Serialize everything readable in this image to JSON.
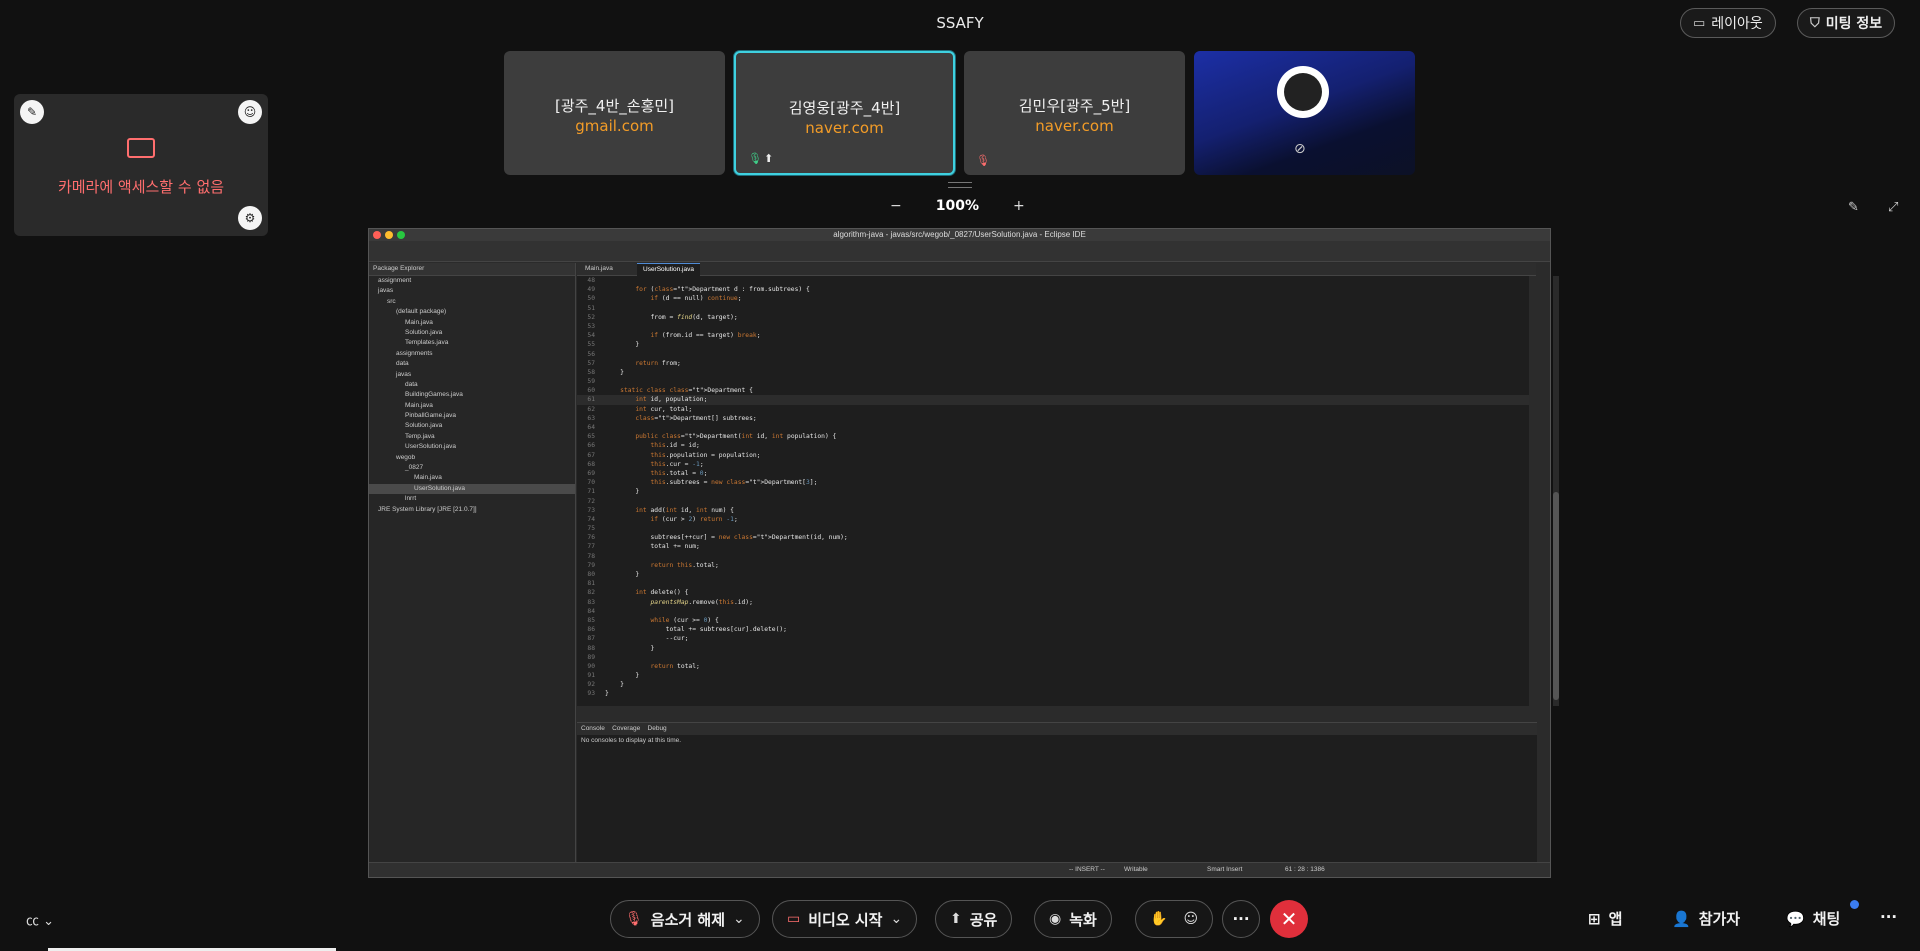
{
  "meeting": {
    "title": "SSAFY"
  },
  "top_buttons": {
    "layout": "레이아웃",
    "meeting_info": "미팅 정보"
  },
  "tiles": [
    {
      "name": "[광주_4반_손홍민]",
      "domain": "gmail.com"
    },
    {
      "name": "김영웅[광주_4반]",
      "domain": "naver.com"
    },
    {
      "name": "김민우[광주_5반]",
      "domain": "naver.com"
    }
  ],
  "self_view": {
    "message": "카메라에 액세스할 수 없음"
  },
  "zoom": {
    "minus": "−",
    "level": "100%",
    "plus": "+"
  },
  "ide": {
    "title": "algorithm-java - javas/src/wegob/_0827/UserSolution.java - Eclipse IDE",
    "package_explorer_tab": "Package Explorer",
    "tree": [
      "assignment",
      "javas",
      "src",
      "(default package)",
      "Main.java",
      "Solution.java",
      "Templates.java",
      "assignments",
      "data",
      "javas",
      "data",
      "BuildingGames.java",
      "Main.java",
      "PinballGame.java",
      "Solution.java",
      "Temp.java",
      "UserSolution.java",
      "wegob",
      "_0827",
      "Main.java",
      "UserSolution.java",
      "lnrrt",
      "JRE System Library [JRE [21.0.7]]"
    ],
    "editor_tabs": [
      "Main.java",
      "UserSolution.java"
    ],
    "code_lines": [
      {
        "n": "48",
        "text": ""
      },
      {
        "n": "49",
        "text": "        for (Department d : from.subtrees) {"
      },
      {
        "n": "50",
        "text": "            if (d == null) continue;"
      },
      {
        "n": "51",
        "text": ""
      },
      {
        "n": "52",
        "text": "            from = find(d, target);"
      },
      {
        "n": "53",
        "text": ""
      },
      {
        "n": "54",
        "text": "            if (from.id == target) break;"
      },
      {
        "n": "55",
        "text": "        }"
      },
      {
        "n": "56",
        "text": ""
      },
      {
        "n": "57",
        "text": "        return from;"
      },
      {
        "n": "58",
        "text": "    }"
      },
      {
        "n": "59",
        "text": ""
      },
      {
        "n": "60",
        "text": "    static class Department {"
      },
      {
        "n": "61",
        "text": "        int id, population;"
      },
      {
        "n": "62",
        "text": "        int cur, total;"
      },
      {
        "n": "63",
        "text": "        Department[] subtrees;"
      },
      {
        "n": "64",
        "text": ""
      },
      {
        "n": "65",
        "text": "        public Department(int id, int population) {"
      },
      {
        "n": "66",
        "text": "            this.id = id;"
      },
      {
        "n": "67",
        "text": "            this.population = population;"
      },
      {
        "n": "68",
        "text": "            this.cur = -1;"
      },
      {
        "n": "69",
        "text": "            this.total = 0;"
      },
      {
        "n": "70",
        "text": "            this.subtrees = new Department[3];"
      },
      {
        "n": "71",
        "text": "        }"
      },
      {
        "n": "72",
        "text": ""
      },
      {
        "n": "73",
        "text": "        int add(int id, int num) {"
      },
      {
        "n": "74",
        "text": "            if (cur > 2) return -1;"
      },
      {
        "n": "75",
        "text": ""
      },
      {
        "n": "76",
        "text": "            subtrees[++cur] = new Department(id, num);"
      },
      {
        "n": "77",
        "text": "            total += num;"
      },
      {
        "n": "78",
        "text": ""
      },
      {
        "n": "79",
        "text": "            return this.total;"
      },
      {
        "n": "80",
        "text": "        }"
      },
      {
        "n": "81",
        "text": ""
      },
      {
        "n": "82",
        "text": "        int delete() {"
      },
      {
        "n": "83",
        "text": "            parentsMap.remove(this.id);"
      },
      {
        "n": "84",
        "text": ""
      },
      {
        "n": "85",
        "text": "            while (cur >= 0) {"
      },
      {
        "n": "86",
        "text": "                total += subtrees[cur].delete();"
      },
      {
        "n": "87",
        "text": "                --cur;"
      },
      {
        "n": "88",
        "text": "            }"
      },
      {
        "n": "89",
        "text": ""
      },
      {
        "n": "90",
        "text": "            return total;"
      },
      {
        "n": "91",
        "text": "        }"
      },
      {
        "n": "92",
        "text": "    }"
      },
      {
        "n": "93",
        "text": "}"
      }
    ],
    "console_tabs": [
      "Console",
      "Coverage",
      "Debug"
    ],
    "console_message": "No consoles to display at this time.",
    "status": {
      "mode": "-- INSERT --",
      "writable": "Writable",
      "insert": "Smart Insert",
      "position": "61 : 28 : 1386"
    }
  },
  "bottom": {
    "unmute": "음소거 해제",
    "start_video": "비디오 시작",
    "share": "공유",
    "record": "녹화",
    "more": "···",
    "apps": "앱",
    "participants": "참가자",
    "chat": "채팅"
  }
}
